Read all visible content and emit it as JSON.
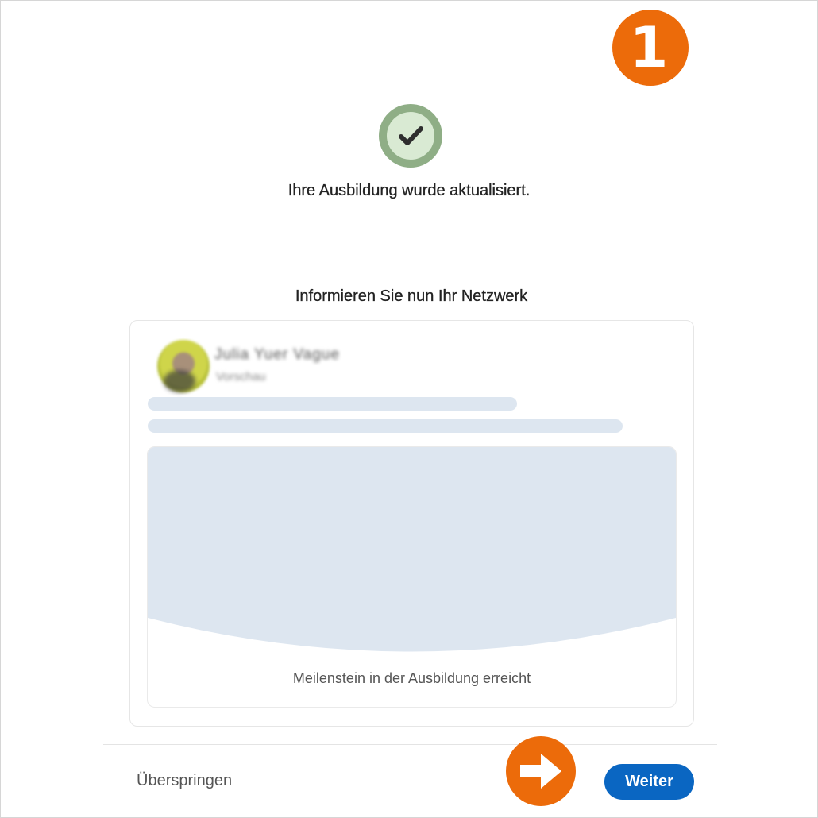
{
  "step_badge": {
    "number": "1",
    "color": "#ec6b0a"
  },
  "success": {
    "icon": "checkmark-icon",
    "message": "Ihre Ausbildung wurde aktualisiert."
  },
  "share": {
    "heading": "Informieren Sie nun Ihr Netzwerk",
    "post_preview": {
      "author_name_blurred": "Julia Yuer Vague",
      "author_subtitle_blurred": "Vorschau",
      "milestone_label": "Meilenstein in der Ausbildung erreicht"
    }
  },
  "footer": {
    "skip_label": "Überspringen",
    "next_label": "Weiter",
    "arrow_icon": "arrow-right-icon"
  },
  "colors": {
    "accent": "#0a66c2",
    "annotation": "#ec6b0a",
    "success_ring": "#8fae86",
    "placeholder": "#dde6f0"
  }
}
